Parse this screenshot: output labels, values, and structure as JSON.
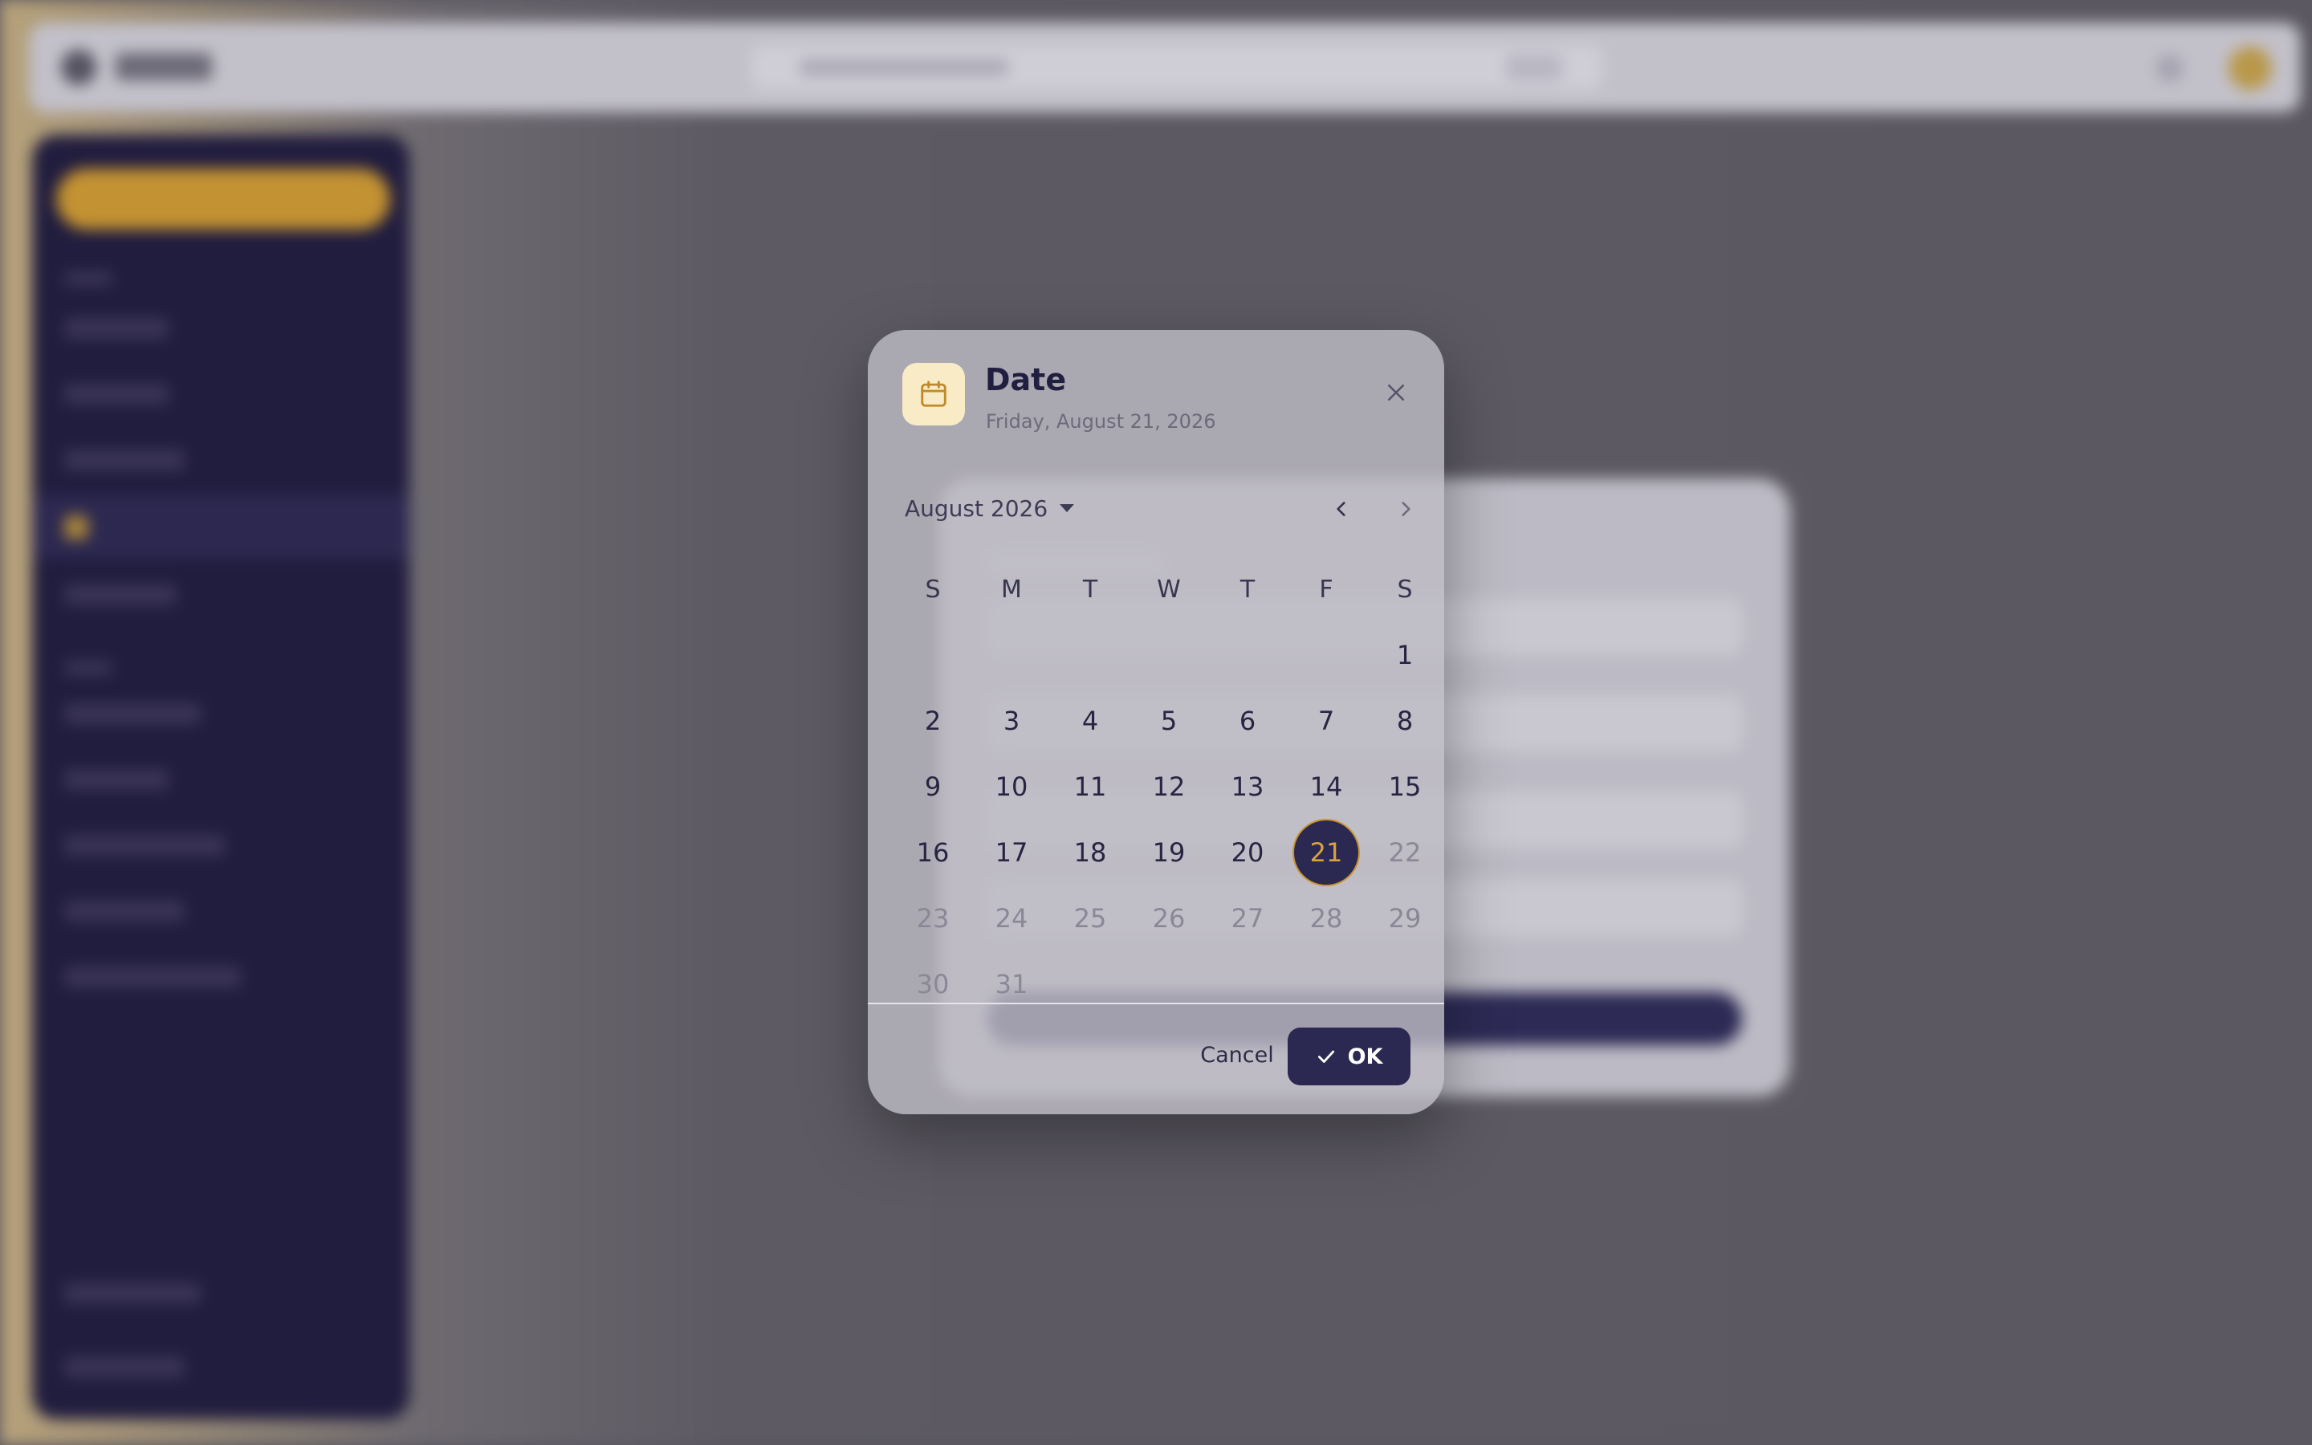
{
  "colors": {
    "accent": "#2b2851",
    "highlight": "#d8a33e",
    "icon_bg": "#f8ebc6",
    "icon_stroke": "#c08a2a"
  },
  "dialog": {
    "icon": "calendar-icon",
    "title": "Date",
    "subtitle": "Friday, August 21, 2026",
    "close_icon": "close-icon",
    "month_label": "August 2026",
    "month_dropdown_icon": "caret-down-icon",
    "prev_icon": "chevron-left-icon",
    "next_icon": "chevron-right-icon",
    "weekdays": [
      "S",
      "M",
      "T",
      "W",
      "T",
      "F",
      "S"
    ],
    "leading_blanks": 6,
    "days_in_month": 31,
    "selected_day": 21,
    "cancel_label": "Cancel",
    "ok_label": "OK",
    "ok_icon": "check-icon"
  }
}
